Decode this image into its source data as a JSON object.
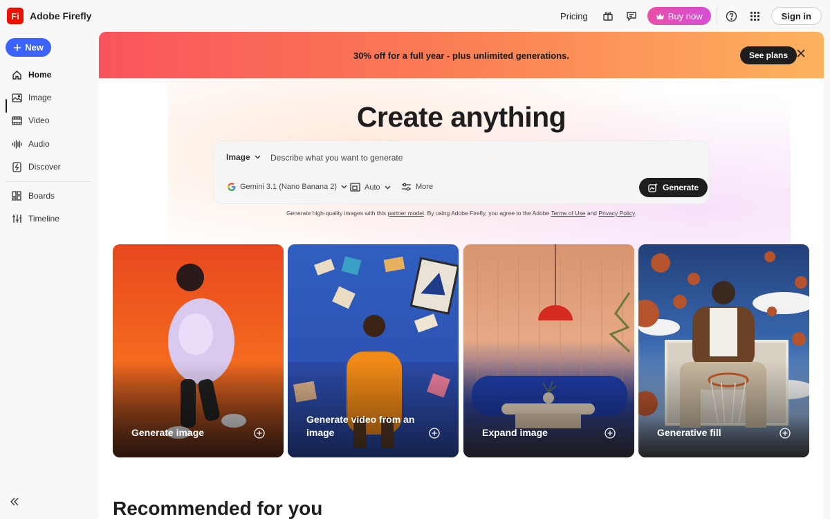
{
  "app": {
    "logo_text": "Fi",
    "name": "Adobe Firefly"
  },
  "topbar": {
    "pricing": "Pricing",
    "buy_now": "Buy now",
    "sign_in": "Sign in"
  },
  "sidebar": {
    "new_label": "New",
    "items": [
      {
        "label": "Home",
        "icon": "home-icon",
        "active": true
      },
      {
        "label": "Image",
        "icon": "image-icon"
      },
      {
        "label": "Video",
        "icon": "video-icon"
      },
      {
        "label": "Audio",
        "icon": "audio-icon"
      },
      {
        "label": "Discover",
        "icon": "discover-icon"
      },
      {
        "label": "Boards",
        "icon": "boards-icon"
      },
      {
        "label": "Timeline",
        "icon": "timeline-icon"
      }
    ]
  },
  "promo": {
    "text": "30% off for a full year  - plus unlimited generations.",
    "cta": "See plans"
  },
  "hero": {
    "title": "Create anything"
  },
  "prompt": {
    "type": "Image",
    "placeholder": "Describe what you want to generate",
    "model": "Gemini 3.1 (Nano Banana 2)",
    "aspect": "Auto",
    "more": "More",
    "generate": "Generate"
  },
  "disclaimer": {
    "p1": "Generate high-quality images with this",
    "link1": "partner model",
    "p2": ". By using Adobe Firefly, you agree to the Adobe",
    "link2": "Terms of Use",
    "p3": "and",
    "link3": "Privacy Policy",
    "p4": "."
  },
  "cards": [
    {
      "label": "Generate image"
    },
    {
      "label": "Generate video from an image"
    },
    {
      "label": "Expand image"
    },
    {
      "label": "Generative fill"
    }
  ],
  "section": {
    "recommended": "Recommended for you"
  },
  "colors": {
    "accent": "#3b63fb",
    "brand": "#eb1000",
    "buy": "#e74fa7"
  }
}
